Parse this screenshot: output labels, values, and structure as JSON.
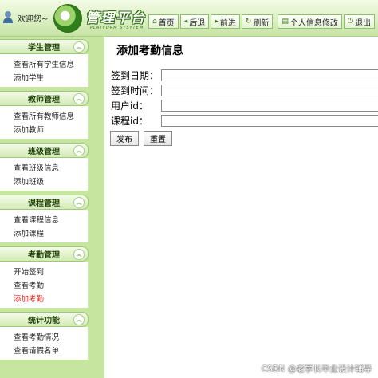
{
  "header": {
    "welcome": "欢迎您~",
    "logo_title": "管理平台",
    "logo_subtitle": "PLATFORM SYSYTEM",
    "toolbar": [
      {
        "icon": "home-icon",
        "label": "首页"
      },
      {
        "icon": "back-icon",
        "label": "后退"
      },
      {
        "icon": "forward-icon",
        "label": "前进"
      },
      {
        "icon": "refresh-icon",
        "label": "刷新"
      },
      {
        "icon": "profile-icon",
        "label": "个人信息修改"
      },
      {
        "icon": "logout-icon",
        "label": "退出"
      }
    ]
  },
  "sidebar": {
    "sections": [
      {
        "title": "学生管理",
        "items": [
          "查看所有学生信息",
          "添加学生"
        ]
      },
      {
        "title": "教师管理",
        "items": [
          "查看所有教师信息",
          "添加教师"
        ]
      },
      {
        "title": "班级管理",
        "items": [
          "查看班级信息",
          "添加班级"
        ]
      },
      {
        "title": "课程管理",
        "items": [
          "查看课程信息",
          "添加课程"
        ]
      },
      {
        "title": "考勤管理",
        "items": [
          "开始签到",
          "查看考勤",
          "添加考勤"
        ]
      },
      {
        "title": "统计功能",
        "items": [
          "查看考勤情况",
          "查看请假名单"
        ]
      }
    ],
    "active_item": "添加考勤"
  },
  "main": {
    "title": "添加考勤信息",
    "fields": [
      {
        "label": "签到日期：",
        "value": ""
      },
      {
        "label": "签到时间：",
        "value": ""
      },
      {
        "label": "用户id：",
        "value": ""
      },
      {
        "label": "课程id：",
        "value": ""
      }
    ],
    "submit_label": "发布",
    "reset_label": "重置"
  },
  "watermark": "CSDN @老学长毕业设计辅导",
  "colors": {
    "accent": "#c6e59f",
    "active_link": "#e0221a"
  }
}
